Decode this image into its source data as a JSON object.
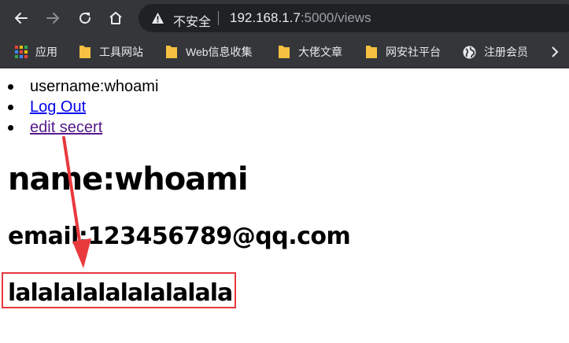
{
  "browser": {
    "back_icon": "arrow-left-icon",
    "forward_icon": "arrow-right-icon",
    "reload_icon": "reload-icon",
    "home_icon": "home-icon",
    "security_icon": "warning-triangle-icon",
    "security_label": "不安全",
    "url_host": "192.168.1.7",
    "url_rest": ":5000/views"
  },
  "bookmarks": [
    {
      "label": "应用",
      "icon": "apps-grid-icon"
    },
    {
      "label": "工具网站",
      "icon": "folder-icon"
    },
    {
      "label": "Web信息收集",
      "icon": "folder-icon"
    },
    {
      "label": "大佬文章",
      "icon": "folder-icon"
    },
    {
      "label": "网安社平台",
      "icon": "folder-icon"
    },
    {
      "label": "注册会员",
      "icon": "globe-icon"
    }
  ],
  "page": {
    "nav": {
      "username": "username:whoami",
      "logout": "Log Out",
      "edit_secret": "edit secert"
    },
    "name_heading": "name:whoami",
    "email_heading": "email:123456789@qq.com",
    "secret_heading": "lalalalalalalalalala"
  },
  "annotation": {
    "color": "#e8393d"
  }
}
